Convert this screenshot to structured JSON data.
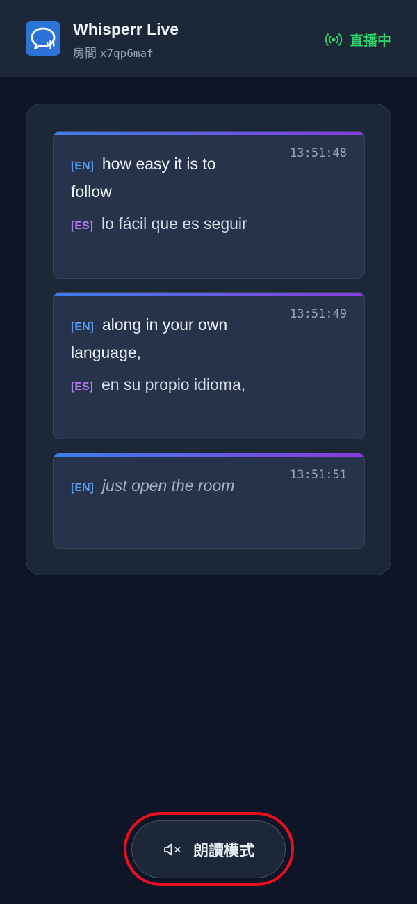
{
  "header": {
    "app_title": "Whisperr Live",
    "room_label": "房間",
    "room_id": "x7qp6maf",
    "status_text": "直播中",
    "status_color": "#2fd36b",
    "logo_icon": "chat-bubble-waveform-icon",
    "status_icon": "broadcast-icon"
  },
  "transcript": {
    "cards": [
      {
        "time": "13:51:48",
        "segments": [
          {
            "lang": "[EN]",
            "text": "how easy it is to follow"
          },
          {
            "lang": "[ES]",
            "text": "lo fácil que es seguir"
          }
        ]
      },
      {
        "time": "13:51:49",
        "segments": [
          {
            "lang": "[EN]",
            "text": "along in your own language,"
          },
          {
            "lang": "[ES]",
            "text": "en su propio idioma,"
          }
        ]
      },
      {
        "time": "13:51:51",
        "segments": [
          {
            "lang": "[EN]",
            "text": "just open the room"
          }
        ]
      }
    ]
  },
  "footer": {
    "tts_label": "朗讀模式",
    "tts_icon": "speaker-muted-icon"
  },
  "colors": {
    "background": "#0d1527",
    "accent_blue": "#3a7ff0",
    "accent_purple": "#8b3ae0",
    "highlight_ring": "#e8101f"
  }
}
